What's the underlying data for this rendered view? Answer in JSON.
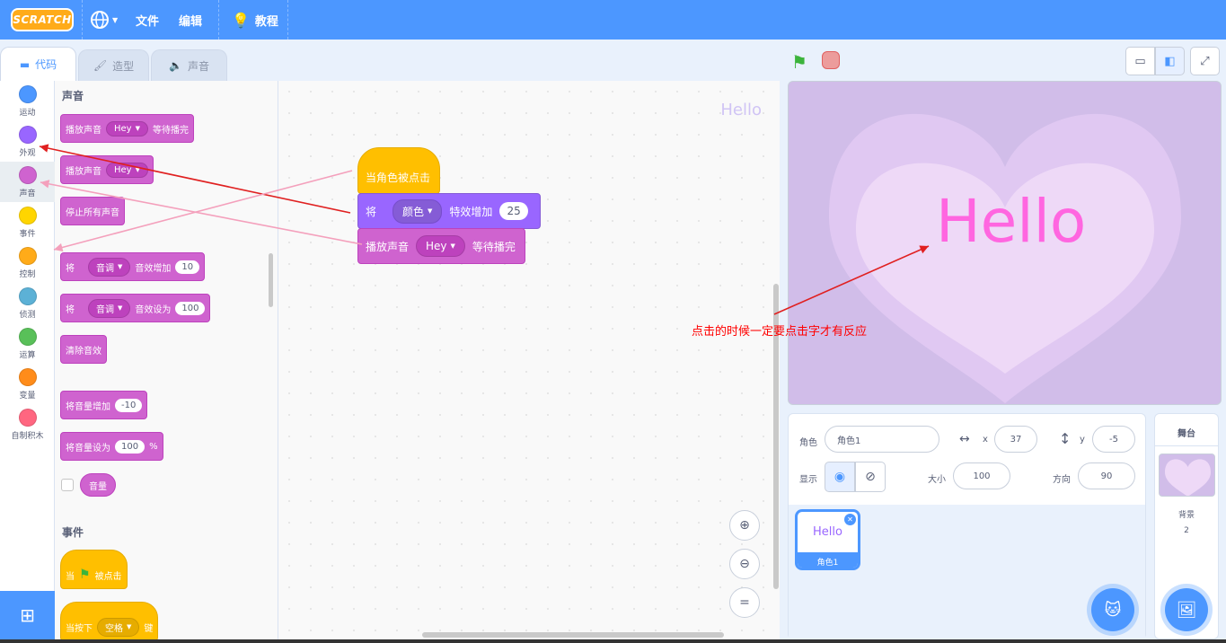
{
  "menu": {
    "logo": "SCRATCH",
    "globe_icon": "globe-icon",
    "file": "文件",
    "edit": "编辑",
    "tutorials": "教程"
  },
  "tabs": [
    {
      "label": "代码",
      "icon": "code-icon"
    },
    {
      "label": "造型",
      "icon": "brush-icon"
    },
    {
      "label": "声音",
      "icon": "speaker-icon"
    }
  ],
  "categories": [
    {
      "label": "运动",
      "color": "#4c97ff"
    },
    {
      "label": "外观",
      "color": "#9966ff"
    },
    {
      "label": "声音",
      "color": "#cf63cf"
    },
    {
      "label": "事件",
      "color": "#ffd500"
    },
    {
      "label": "控制",
      "color": "#ffab19"
    },
    {
      "label": "侦测",
      "color": "#5cb1d6"
    },
    {
      "label": "运算",
      "color": "#59c059"
    },
    {
      "label": "变量",
      "color": "#ff8c1a"
    },
    {
      "label": "自制积木",
      "color": "#ff6680"
    }
  ],
  "palette": {
    "sound_heading": "声音",
    "play_until_done": {
      "text": "播放声音",
      "sound": "Hey",
      "suffix": "等待播完"
    },
    "start_sound": {
      "text": "播放声音",
      "sound": "Hey"
    },
    "stop_all_sounds": "停止所有声音",
    "change_effect": {
      "prefix": "将",
      "effect": "音调",
      "middle": "音效增加",
      "value": "10"
    },
    "set_effect": {
      "prefix": "将",
      "effect": "音调",
      "middle": "音效设为",
      "value": "100"
    },
    "clear_effects": "清除音效",
    "change_volume": {
      "text": "将音量增加",
      "value": "-10"
    },
    "set_volume": {
      "text": "将音量设为",
      "value": "100",
      "suffix": "%"
    },
    "volume_reporter": "音量",
    "events_heading": "事件",
    "when_flag": {
      "prefix": "当",
      "suffix": "被点击"
    },
    "when_key": {
      "prefix": "当按下",
      "key": "空格",
      "suffix": "键"
    }
  },
  "script": {
    "hat": "当角色被点击",
    "looks": {
      "prefix": "将",
      "effect": "颜色",
      "middle": "特效增加",
      "value": "25"
    },
    "sound": {
      "prefix": "播放声音",
      "sound": "Hey",
      "suffix": "等待播完"
    }
  },
  "code_area": {
    "sprite_name_watermark": "Hello"
  },
  "stage": {
    "text": "Hello"
  },
  "annotation": "点击的时候一定要点击字才有反应",
  "sprite_info": {
    "sprite_label": "角色",
    "sprite_name": "角色1",
    "x_label": "x",
    "x_value": "37",
    "y_label": "y",
    "y_value": "-5",
    "show_label": "显示",
    "size_label": "大小",
    "size_value": "100",
    "direction_label": "方向",
    "direction_value": "90"
  },
  "sprite_list": [
    {
      "thumb_text": "Hello",
      "name": "角色1"
    }
  ],
  "stage_pane": {
    "title": "舞台",
    "backdrops_label": "背景",
    "backdrops_count": "2"
  },
  "colors": {
    "accent": "#4c97ff",
    "annotation": "#ff0000"
  }
}
